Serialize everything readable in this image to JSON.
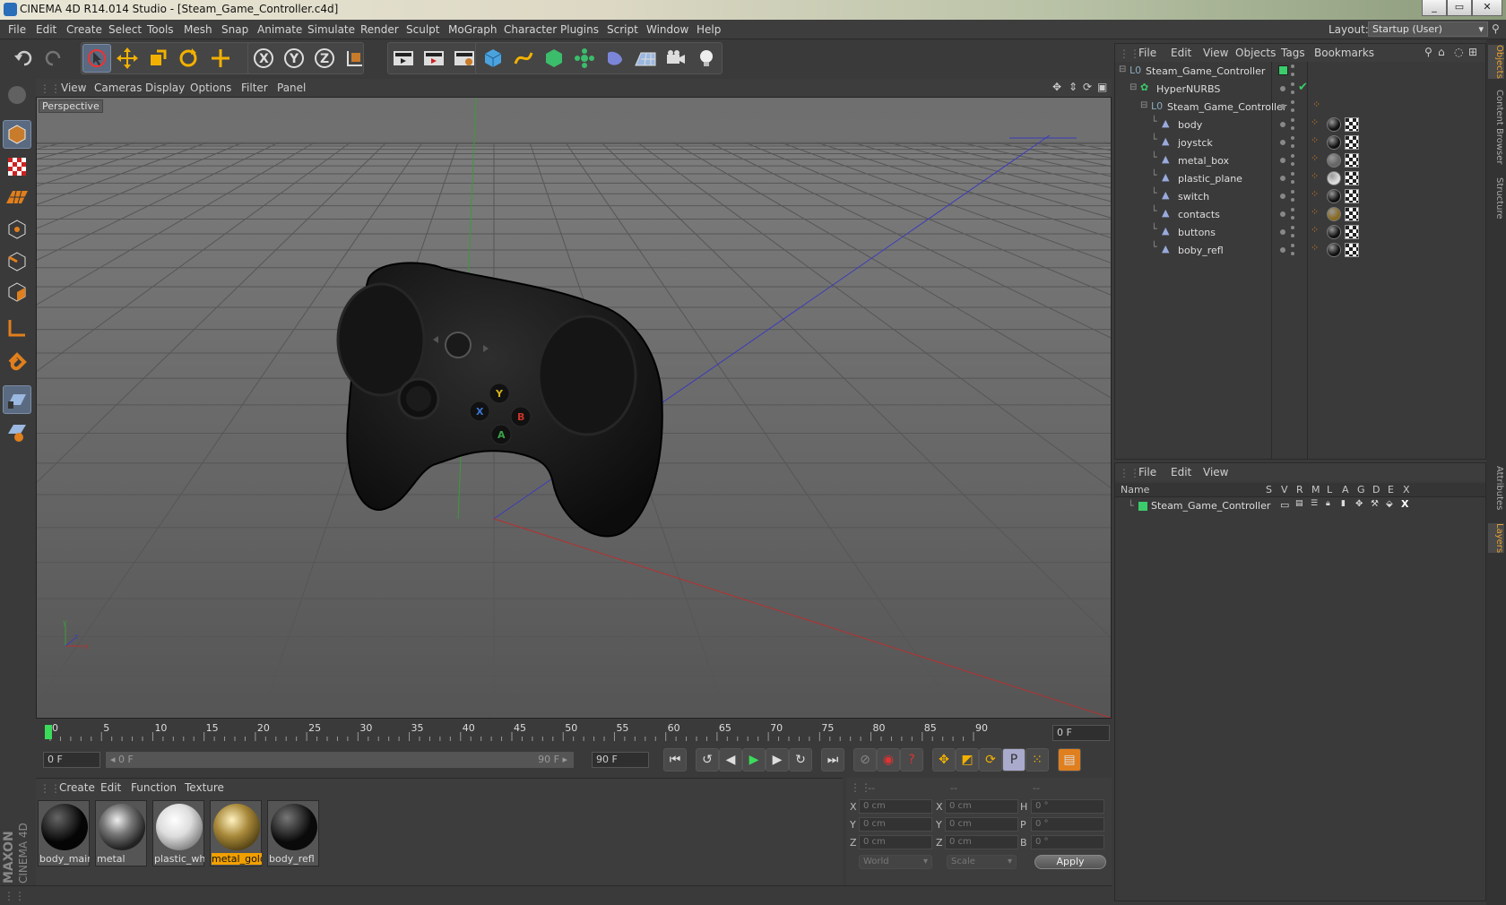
{
  "window": {
    "title": "CINEMA 4D R14.014 Studio - [Steam_Game_Controller.c4d]"
  },
  "menubar": {
    "items": [
      "File",
      "Edit",
      "Create",
      "Select",
      "Tools",
      "Mesh",
      "Snap",
      "Animate",
      "Simulate",
      "Render",
      "Sculpt",
      "MoGraph",
      "Character",
      "Plugins",
      "Script",
      "Window",
      "Help"
    ],
    "layout_label": "Layout:",
    "layout_value": "Startup (User)"
  },
  "viewport": {
    "menu": [
      "View",
      "Cameras",
      "Display",
      "Options",
      "Filter",
      "Panel"
    ],
    "label": "Perspective"
  },
  "timeline": {
    "ticks": [
      "0",
      "5",
      "10",
      "15",
      "20",
      "25",
      "30",
      "35",
      "40",
      "45",
      "50",
      "55",
      "60",
      "65",
      "70",
      "75",
      "80",
      "85",
      "90"
    ],
    "current_frame": "0 F",
    "start_field": "0 F",
    "range_start": "0 F",
    "range_end": "90 F",
    "end_field": "90 F"
  },
  "materials": {
    "menu": [
      "Create",
      "Edit",
      "Function",
      "Texture"
    ],
    "items": [
      {
        "name": "body_main",
        "selected": false
      },
      {
        "name": "metal",
        "selected": false
      },
      {
        "name": "plastic_whi",
        "selected": false
      },
      {
        "name": "metal_gold",
        "selected": true
      },
      {
        "name": "body_refl",
        "selected": false
      }
    ]
  },
  "coords": {
    "headers": [
      "--",
      "--",
      "--"
    ],
    "rows": [
      {
        "a": "X",
        "av": "0 cm",
        "b": "X",
        "bv": "0 cm",
        "c": "H",
        "cv": "0 °"
      },
      {
        "a": "Y",
        "av": "0 cm",
        "b": "Y",
        "bv": "0 cm",
        "c": "P",
        "cv": "0 °"
      },
      {
        "a": "Z",
        "av": "0 cm",
        "b": "Z",
        "bv": "0 cm",
        "c": "B",
        "cv": "0 °"
      }
    ],
    "world": "World",
    "scale": "Scale",
    "apply": "Apply"
  },
  "objects": {
    "menu": [
      "File",
      "Edit",
      "View",
      "Objects",
      "Tags",
      "Bookmarks"
    ],
    "rows": [
      {
        "name": "Steam_Game_Controller"
      },
      {
        "name": "HyperNURBS"
      },
      {
        "name": "Steam_Game_Controller"
      },
      {
        "name": "body"
      },
      {
        "name": "joystck"
      },
      {
        "name": "metal_box"
      },
      {
        "name": "plastic_plane"
      },
      {
        "name": "switch"
      },
      {
        "name": "contacts"
      },
      {
        "name": "buttons"
      },
      {
        "name": "boby_refl"
      }
    ]
  },
  "layers": {
    "menu": [
      "File",
      "Edit",
      "View"
    ],
    "name_col": "Name",
    "cols": [
      "S",
      "V",
      "R",
      "M",
      "L",
      "A",
      "G",
      "D",
      "E",
      "X"
    ],
    "rows": [
      {
        "name": "Steam_Game_Controller"
      }
    ]
  },
  "sidetabs": [
    "Objects",
    "Content Browser",
    "Structure",
    "Attributes",
    "Layers"
  ],
  "brand": {
    "maxon": "MAXON",
    "c4d": "CINEMA 4D"
  }
}
